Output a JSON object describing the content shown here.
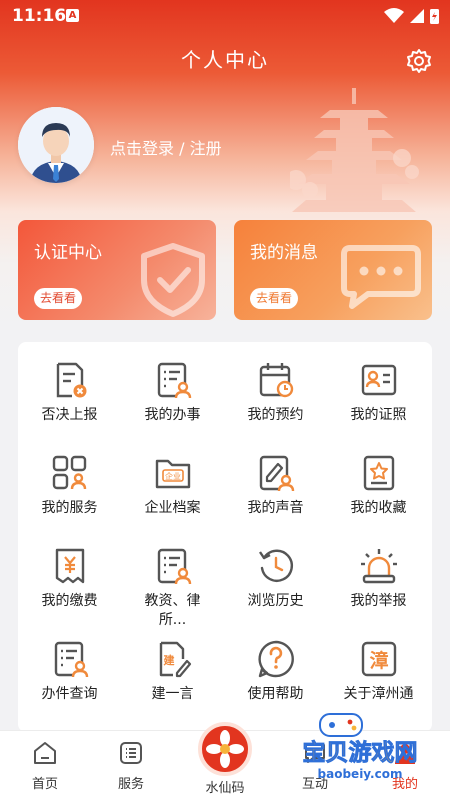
{
  "status": {
    "time": "11:16",
    "notif_badge": "A"
  },
  "header": {
    "title": "个人中心"
  },
  "profile": {
    "login_text": "点击登录 / 注册"
  },
  "cards": [
    {
      "title": "认证中心",
      "button": "去看看",
      "icon": "shield-check-icon"
    },
    {
      "title": "我的消息",
      "button": "去看看",
      "icon": "message-bubble-icon"
    }
  ],
  "grid": [
    {
      "label": "否决上报",
      "icon": "doc-reject-icon"
    },
    {
      "label": "我的办事",
      "icon": "list-user-icon"
    },
    {
      "label": "我的预约",
      "icon": "calendar-clock-icon"
    },
    {
      "label": "我的证照",
      "icon": "id-card-icon"
    },
    {
      "label": "我的服务",
      "icon": "grid-user-icon"
    },
    {
      "label": "企业档案",
      "icon": "folder-enterprise-icon"
    },
    {
      "label": "我的声音",
      "icon": "edit-user-icon"
    },
    {
      "label": "我的收藏",
      "icon": "star-box-icon"
    },
    {
      "label": "我的缴费",
      "icon": "yuan-receipt-icon"
    },
    {
      "label": "教资、律所...",
      "icon": "list-user-icon"
    },
    {
      "label": "浏览历史",
      "icon": "history-icon"
    },
    {
      "label": "我的举报",
      "icon": "alarm-light-icon"
    },
    {
      "label": "办件查询",
      "icon": "list-user-icon"
    },
    {
      "label": "建一言",
      "icon": "doc-edit-icon"
    },
    {
      "label": "使用帮助",
      "icon": "help-icon"
    },
    {
      "label": "关于漳州通",
      "icon": "zhang-seal-icon"
    }
  ],
  "tabbar": [
    {
      "label": "首页",
      "icon": "home-icon"
    },
    {
      "label": "服务",
      "icon": "service-list-icon"
    },
    {
      "label": "水仙码",
      "icon": "narcissus-icon"
    },
    {
      "label": "互动",
      "icon": "interaction-icon"
    },
    {
      "label": "我的",
      "icon": "profile-icon"
    }
  ],
  "watermark": {
    "main": "宝贝游戏网",
    "sub": "baobeiy.com"
  },
  "colors": {
    "primary": "#e2351f",
    "accent": "#f08a3c",
    "icon_dark": "#555555"
  }
}
